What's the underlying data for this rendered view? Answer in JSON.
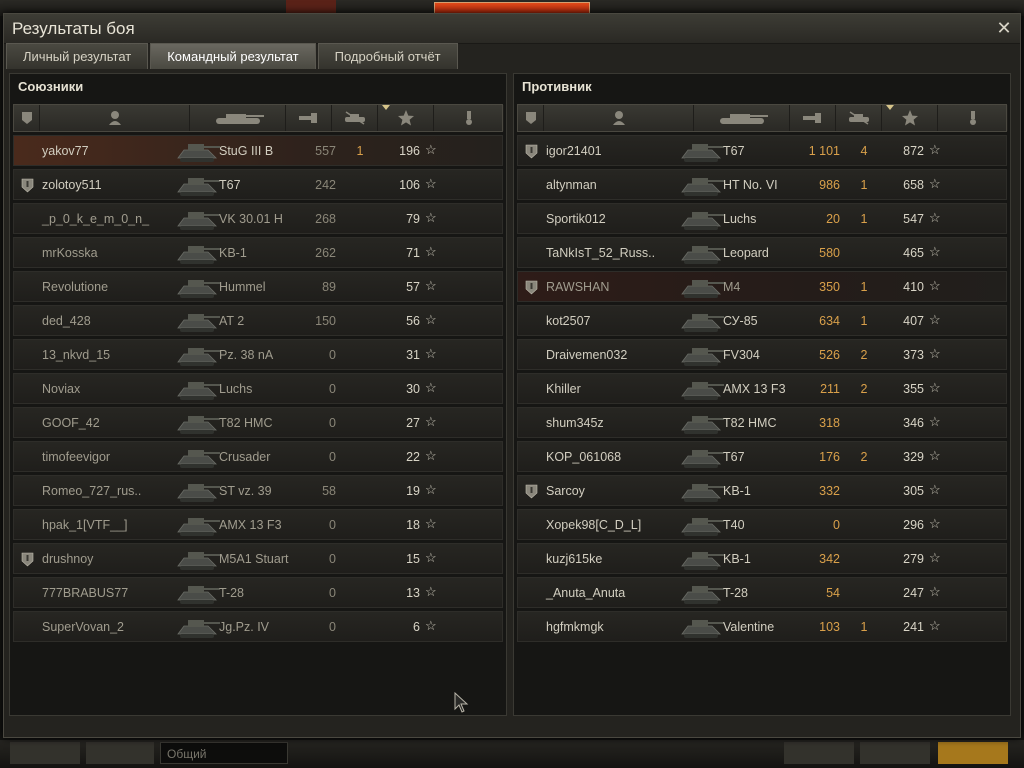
{
  "window": {
    "title": "Результаты боя",
    "close": "✕"
  },
  "tabs": [
    {
      "label": "Личный результат"
    },
    {
      "label": "Командный результат"
    },
    {
      "label": "Подробный отчёт"
    }
  ],
  "bottom_bar": {
    "chat_placeholder": "Общий"
  },
  "allies": {
    "title": "Союзники",
    "rows": [
      {
        "name": "yakov77",
        "vehicle": "StuG III B",
        "damage": "557",
        "kills": "1",
        "xp": "196",
        "clan": false,
        "state": "self"
      },
      {
        "name": "zolotoy511",
        "vehicle": "T67",
        "damage": "242",
        "kills": "",
        "xp": "106",
        "clan": true,
        "state": "alive"
      },
      {
        "name": "_p_0_k_e_m_0_n_",
        "vehicle": "VK 30.01 H",
        "damage": "268",
        "kills": "",
        "xp": "79",
        "clan": false,
        "state": "dead"
      },
      {
        "name": "mrKosska",
        "vehicle": "KB-1",
        "damage": "262",
        "kills": "",
        "xp": "71",
        "clan": false,
        "state": "dead"
      },
      {
        "name": "Revolutione",
        "vehicle": "Hummel",
        "damage": "89",
        "kills": "",
        "xp": "57",
        "clan": false,
        "state": "dead"
      },
      {
        "name": "ded_428",
        "vehicle": "AT 2",
        "damage": "150",
        "kills": "",
        "xp": "56",
        "clan": false,
        "state": "dead"
      },
      {
        "name": "13_nkvd_15",
        "vehicle": "Pz. 38 nA",
        "damage": "0",
        "kills": "",
        "xp": "31",
        "clan": false,
        "state": "dead"
      },
      {
        "name": "Noviax",
        "vehicle": "Luchs",
        "damage": "0",
        "kills": "",
        "xp": "30",
        "clan": false,
        "state": "dead"
      },
      {
        "name": "GOOF_42",
        "vehicle": "T82 HMC",
        "damage": "0",
        "kills": "",
        "xp": "27",
        "clan": false,
        "state": "dead"
      },
      {
        "name": "timofeevigor",
        "vehicle": "Crusader",
        "damage": "0",
        "kills": "",
        "xp": "22",
        "clan": false,
        "state": "dead"
      },
      {
        "name": "Romeo_727_rus..",
        "vehicle": "ST vz. 39",
        "damage": "58",
        "kills": "",
        "xp": "19",
        "clan": false,
        "state": "dead"
      },
      {
        "name": "hpak_1[VTF__]",
        "vehicle": "AMX 13 F3",
        "damage": "0",
        "kills": "",
        "xp": "18",
        "clan": false,
        "state": "dead"
      },
      {
        "name": "drushnoy",
        "vehicle": "M5A1 Stuart",
        "damage": "0",
        "kills": "",
        "xp": "15",
        "clan": true,
        "state": "dead"
      },
      {
        "name": "777BRABUS77",
        "vehicle": "T-28",
        "damage": "0",
        "kills": "",
        "xp": "13",
        "clan": false,
        "state": "dead"
      },
      {
        "name": "SuperVovan_2",
        "vehicle": "Jg.Pz. IV",
        "damage": "0",
        "kills": "",
        "xp": "6",
        "clan": false,
        "state": "dead"
      }
    ]
  },
  "enemies": {
    "title": "Противник",
    "rows": [
      {
        "name": "igor21401",
        "vehicle": "T67",
        "damage": "1 101",
        "kills": "4",
        "xp": "872",
        "clan": true,
        "state": "alive"
      },
      {
        "name": "altynman",
        "vehicle": "HT No. VI",
        "damage": "986",
        "kills": "1",
        "xp": "658",
        "clan": false,
        "state": "alive"
      },
      {
        "name": "Sportik012",
        "vehicle": "Luchs",
        "damage": "20",
        "kills": "1",
        "xp": "547",
        "clan": false,
        "state": "alive"
      },
      {
        "name": "TaNkIsT_52_Russ..",
        "vehicle": "Leopard",
        "damage": "580",
        "kills": "",
        "xp": "465",
        "clan": false,
        "state": "alive"
      },
      {
        "name": "RAWSHAN",
        "vehicle": "M4",
        "damage": "350",
        "kills": "1",
        "xp": "410",
        "clan": true,
        "state": "dead"
      },
      {
        "name": "kot2507",
        "vehicle": "СУ-85",
        "damage": "634",
        "kills": "1",
        "xp": "407",
        "clan": false,
        "state": "alive"
      },
      {
        "name": "Draivemen032",
        "vehicle": "FV304",
        "damage": "526",
        "kills": "2",
        "xp": "373",
        "clan": false,
        "state": "alive"
      },
      {
        "name": "Khiller",
        "vehicle": "AMX 13 F3",
        "damage": "211",
        "kills": "2",
        "xp": "355",
        "clan": false,
        "state": "alive"
      },
      {
        "name": "shum345z",
        "vehicle": "T82 HMC",
        "damage": "318",
        "kills": "",
        "xp": "346",
        "clan": false,
        "state": "alive"
      },
      {
        "name": "KOP_061068",
        "vehicle": "T67",
        "damage": "176",
        "kills": "2",
        "xp": "329",
        "clan": false,
        "state": "alive"
      },
      {
        "name": "Sarcoy",
        "vehicle": "KB-1",
        "damage": "332",
        "kills": "",
        "xp": "305",
        "clan": true,
        "state": "alive"
      },
      {
        "name": "Xopek98[C_D_L]",
        "vehicle": "T40",
        "damage": "0",
        "kills": "",
        "xp": "296",
        "clan": false,
        "state": "alive"
      },
      {
        "name": "kuzj615ke",
        "vehicle": "KB-1",
        "damage": "342",
        "kills": "",
        "xp": "279",
        "clan": false,
        "state": "alive"
      },
      {
        "name": "_Anuta_Anuta",
        "vehicle": "T-28",
        "damage": "54",
        "kills": "",
        "xp": "247",
        "clan": false,
        "state": "alive"
      },
      {
        "name": "hgfmkmgk",
        "vehicle": "Valentine",
        "damage": "103",
        "kills": "1",
        "xp": "241",
        "clan": false,
        "state": "alive"
      }
    ]
  },
  "column_icons": [
    "squad-icon",
    "player-icon",
    "tank-icon",
    "damage-icon",
    "kills-icon",
    "xp-star-icon",
    "medal-icon"
  ],
  "colors": {
    "kills": "#d9a04a",
    "enemy_damage": "#d9a04a",
    "self_row": "#4a2a1c"
  }
}
